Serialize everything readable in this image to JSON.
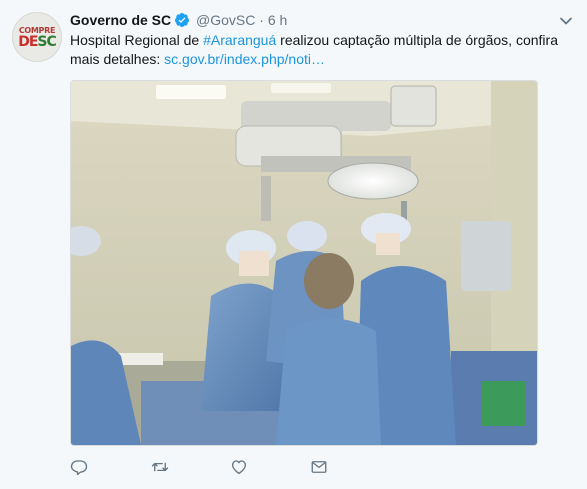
{
  "tweet": {
    "avatar": {
      "line1": "COMPRE",
      "line2a": "DE",
      "line2b": "SC"
    },
    "author_name": "Governo de SC",
    "handle": "@GovSC",
    "separator": "·",
    "time": "6 h",
    "text_before": "Hospital Regional de ",
    "hashtag": "#Araranguá",
    "text_middle": " realizou captação múltipla de órgãos, confira mais detalhes: ",
    "link": "sc.gov.br/index.php/noti…",
    "media_subject": "surgical-team-operating-room-photo"
  },
  "icons": {
    "verified": "verified-badge-icon",
    "caret": "chevron-down-icon",
    "reply": "reply-icon",
    "retweet": "retweet-icon",
    "like": "heart-icon",
    "dm": "envelope-icon"
  },
  "colors": {
    "link": "#1b95e0",
    "muted": "#657786",
    "verified": "#1da1f2",
    "background": "#f5f8fa"
  }
}
